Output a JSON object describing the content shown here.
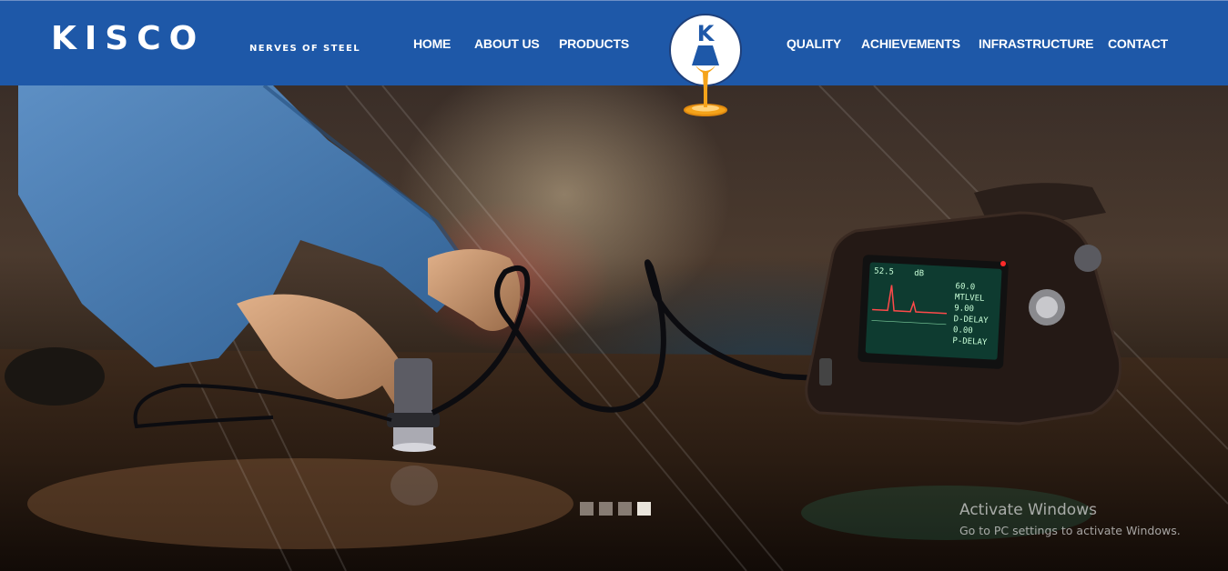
{
  "header": {
    "brand": "KISCO",
    "tagline": "NERVES OF STEEL",
    "logo_letter": "K",
    "nav_left": [
      "HOME",
      "ABOUT US",
      "PRODUCTS"
    ],
    "nav_right": [
      "QUALITY",
      "ACHIEVEMENTS",
      "INFRASTRUCTURE",
      "CONTACT"
    ]
  },
  "hero": {
    "slides_total": 4,
    "active_slide": 4,
    "device_screen": {
      "top_left": "52.5",
      "top_mid": "dB",
      "line1": "60.0",
      "line2": "MTLVEL",
      "line3": "9.00",
      "line4": "D-DELAY",
      "line5": "0.00",
      "line6": "P-DELAY"
    }
  },
  "watermark": {
    "title": "Activate Windows",
    "subtitle": "Go to PC settings to activate Windows."
  },
  "colors": {
    "nav_bg": "#1e58a8",
    "nav_text": "#ffffff",
    "logo_blue": "#1e58a8",
    "logo_orange": "#f5a31a"
  }
}
